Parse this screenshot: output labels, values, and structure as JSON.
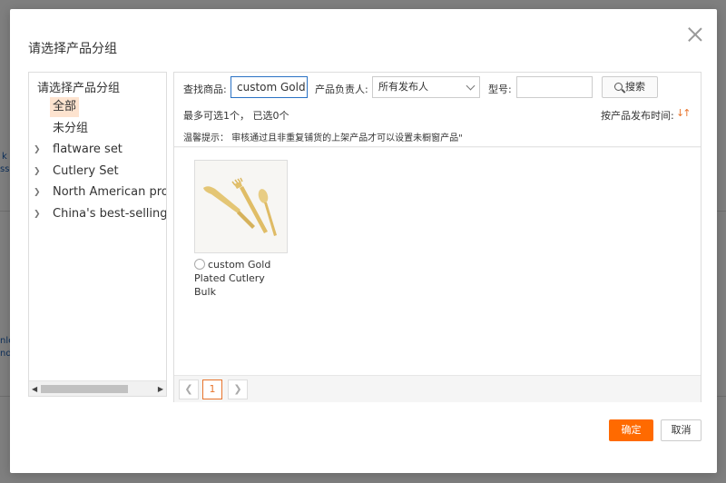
{
  "background": {
    "snippets": [
      "k s",
      "ss s",
      "nle",
      "nd s"
    ]
  },
  "modal": {
    "title": "请选择产品分组",
    "close_icon": "close-icon"
  },
  "tree": {
    "root_label": "请选择产品分组",
    "items": [
      {
        "label": "全部",
        "selected": true,
        "expandable": false
      },
      {
        "label": "未分组",
        "selected": false,
        "expandable": false
      },
      {
        "label": "flatware set",
        "selected": false,
        "expandable": true
      },
      {
        "label": "Cutlery Set",
        "selected": false,
        "expandable": true
      },
      {
        "label": "North American products",
        "selected": false,
        "expandable": true
      },
      {
        "label": "China's best-selling products",
        "selected": false,
        "expandable": true
      }
    ]
  },
  "filters": {
    "search_label": "查找商品:",
    "search_value": "custom Gold Plated",
    "owner_label": "产品负责人:",
    "owner_value": "所有发布人",
    "model_label": "型号:",
    "model_value": "",
    "search_button": "搜索",
    "selection_info": "最多可选1个， 已选0个",
    "sort_label": "按产品发布时间:",
    "tip": "温馨提示： 审核通过且非重复铺货的上架产品才可以设置未橱窗产品\""
  },
  "products": [
    {
      "name": "custom Gold Plated Cutlery Bulk",
      "selected": false
    }
  ],
  "pagination": {
    "prev_icon": "chevron-left-icon",
    "current": "1",
    "next_icon": "chevron-right-icon"
  },
  "footer": {
    "ok_label": "确定",
    "cancel_label": "取消"
  },
  "colors": {
    "accent": "#ff6a00",
    "selected_bg": "#fde3cf",
    "focus_border": "#2a72c4"
  }
}
